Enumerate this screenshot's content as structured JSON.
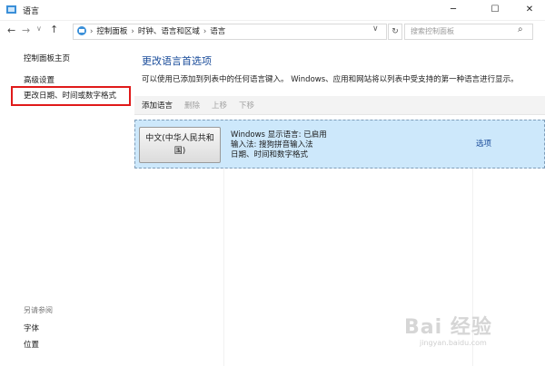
{
  "window": {
    "title": "语言"
  },
  "nav": {
    "breadcrumbs": [
      "控制面板",
      "时钟、语言和区域",
      "语言"
    ],
    "search_placeholder": "搜索控制面板"
  },
  "sidebar": {
    "home": "控制面板主页",
    "advanced": "高级设置",
    "change_date": "更改日期、时间或数字格式",
    "see_also": "另请参阅",
    "fonts": "字体",
    "location": "位置"
  },
  "main": {
    "heading": "更改语言首选项",
    "description": "可以使用已添加到列表中的任何语言键入。 Windows、应用和网站将以列表中受支持的第一种语言进行显示。",
    "toolbar": {
      "add": "添加语言",
      "remove": "删除",
      "up": "上移",
      "down": "下移"
    },
    "language": {
      "name": "中文(中华人民共和国)",
      "display_status": "Windows 显示语言: 已启用",
      "input_method": "输入法: 搜狗拼音输入法",
      "formats": "日期、时间和数字格式",
      "options": "选项"
    }
  },
  "watermark": {
    "logo": "Bai 经验",
    "url": "jingyan.baidu.com"
  },
  "colors": {
    "highlight": "#e01a1a",
    "link": "#1a4c9a",
    "selected_row": "#cde8fb"
  }
}
